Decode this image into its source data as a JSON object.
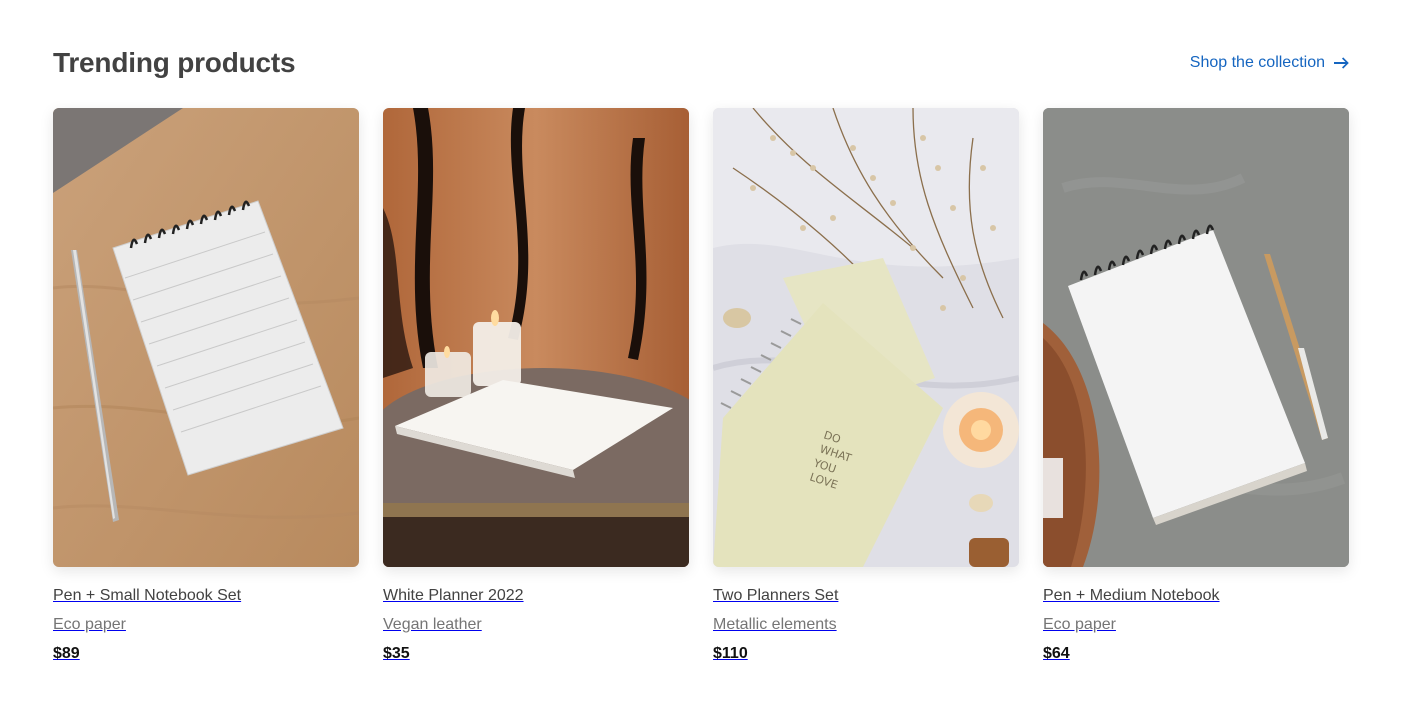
{
  "section": {
    "title": "Trending products",
    "link_label": "Shop the collection",
    "link_icon": "arrow-right-icon"
  },
  "products": [
    {
      "name": "Pen + Small Notebook Set",
      "material": "Eco paper",
      "price": "$89"
    },
    {
      "name": "White Planner 2022",
      "material": "Vegan leather",
      "price": "$35"
    },
    {
      "name": "Two Planners Set",
      "material": "Metallic elements",
      "price": "$110"
    },
    {
      "name": "Pen + Medium Notebook",
      "material": "Eco paper",
      "price": "$64"
    }
  ],
  "colors": {
    "accent": "#1565c0",
    "title": "#424242",
    "muted": "#757575"
  }
}
